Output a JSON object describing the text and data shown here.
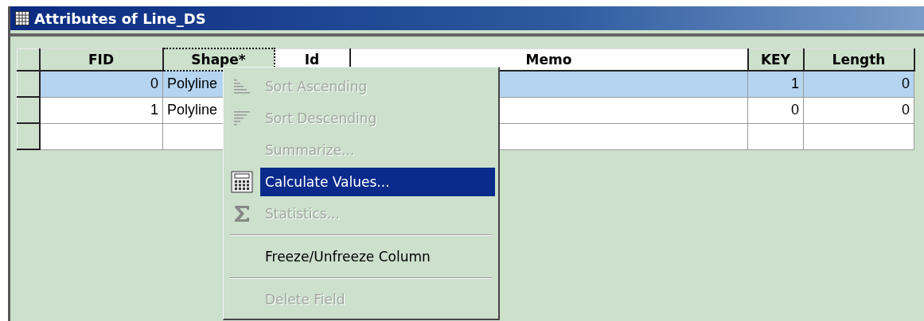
{
  "window": {
    "title": "Attributes of Line_DS"
  },
  "table": {
    "columns": [
      "FID",
      "Shape*",
      "Id",
      "Memo",
      "KEY",
      "Length"
    ],
    "rows": [
      {
        "selected": true,
        "cells": [
          "0",
          "Polyline",
          "",
          "",
          "1",
          "0"
        ]
      },
      {
        "selected": false,
        "cells": [
          "1",
          "Polyline",
          "",
          "",
          "0",
          "0"
        ]
      }
    ]
  },
  "context_menu": {
    "items": [
      {
        "kind": "item",
        "label": "Sort Ascending",
        "disabled": true,
        "selected": false
      },
      {
        "kind": "item",
        "label": "Sort Descending",
        "disabled": true,
        "selected": false
      },
      {
        "kind": "item",
        "label": "Summarize...",
        "disabled": true,
        "selected": false
      },
      {
        "kind": "item",
        "label": "Calculate Values...",
        "disabled": false,
        "selected": true
      },
      {
        "kind": "item",
        "label": "Statistics...",
        "disabled": true,
        "selected": false
      },
      {
        "kind": "separator"
      },
      {
        "kind": "item",
        "label": "Freeze/Unfreeze Column",
        "disabled": false,
        "selected": false
      },
      {
        "kind": "separator"
      },
      {
        "kind": "item",
        "label": "Delete Field",
        "disabled": true,
        "selected": false
      }
    ]
  }
}
